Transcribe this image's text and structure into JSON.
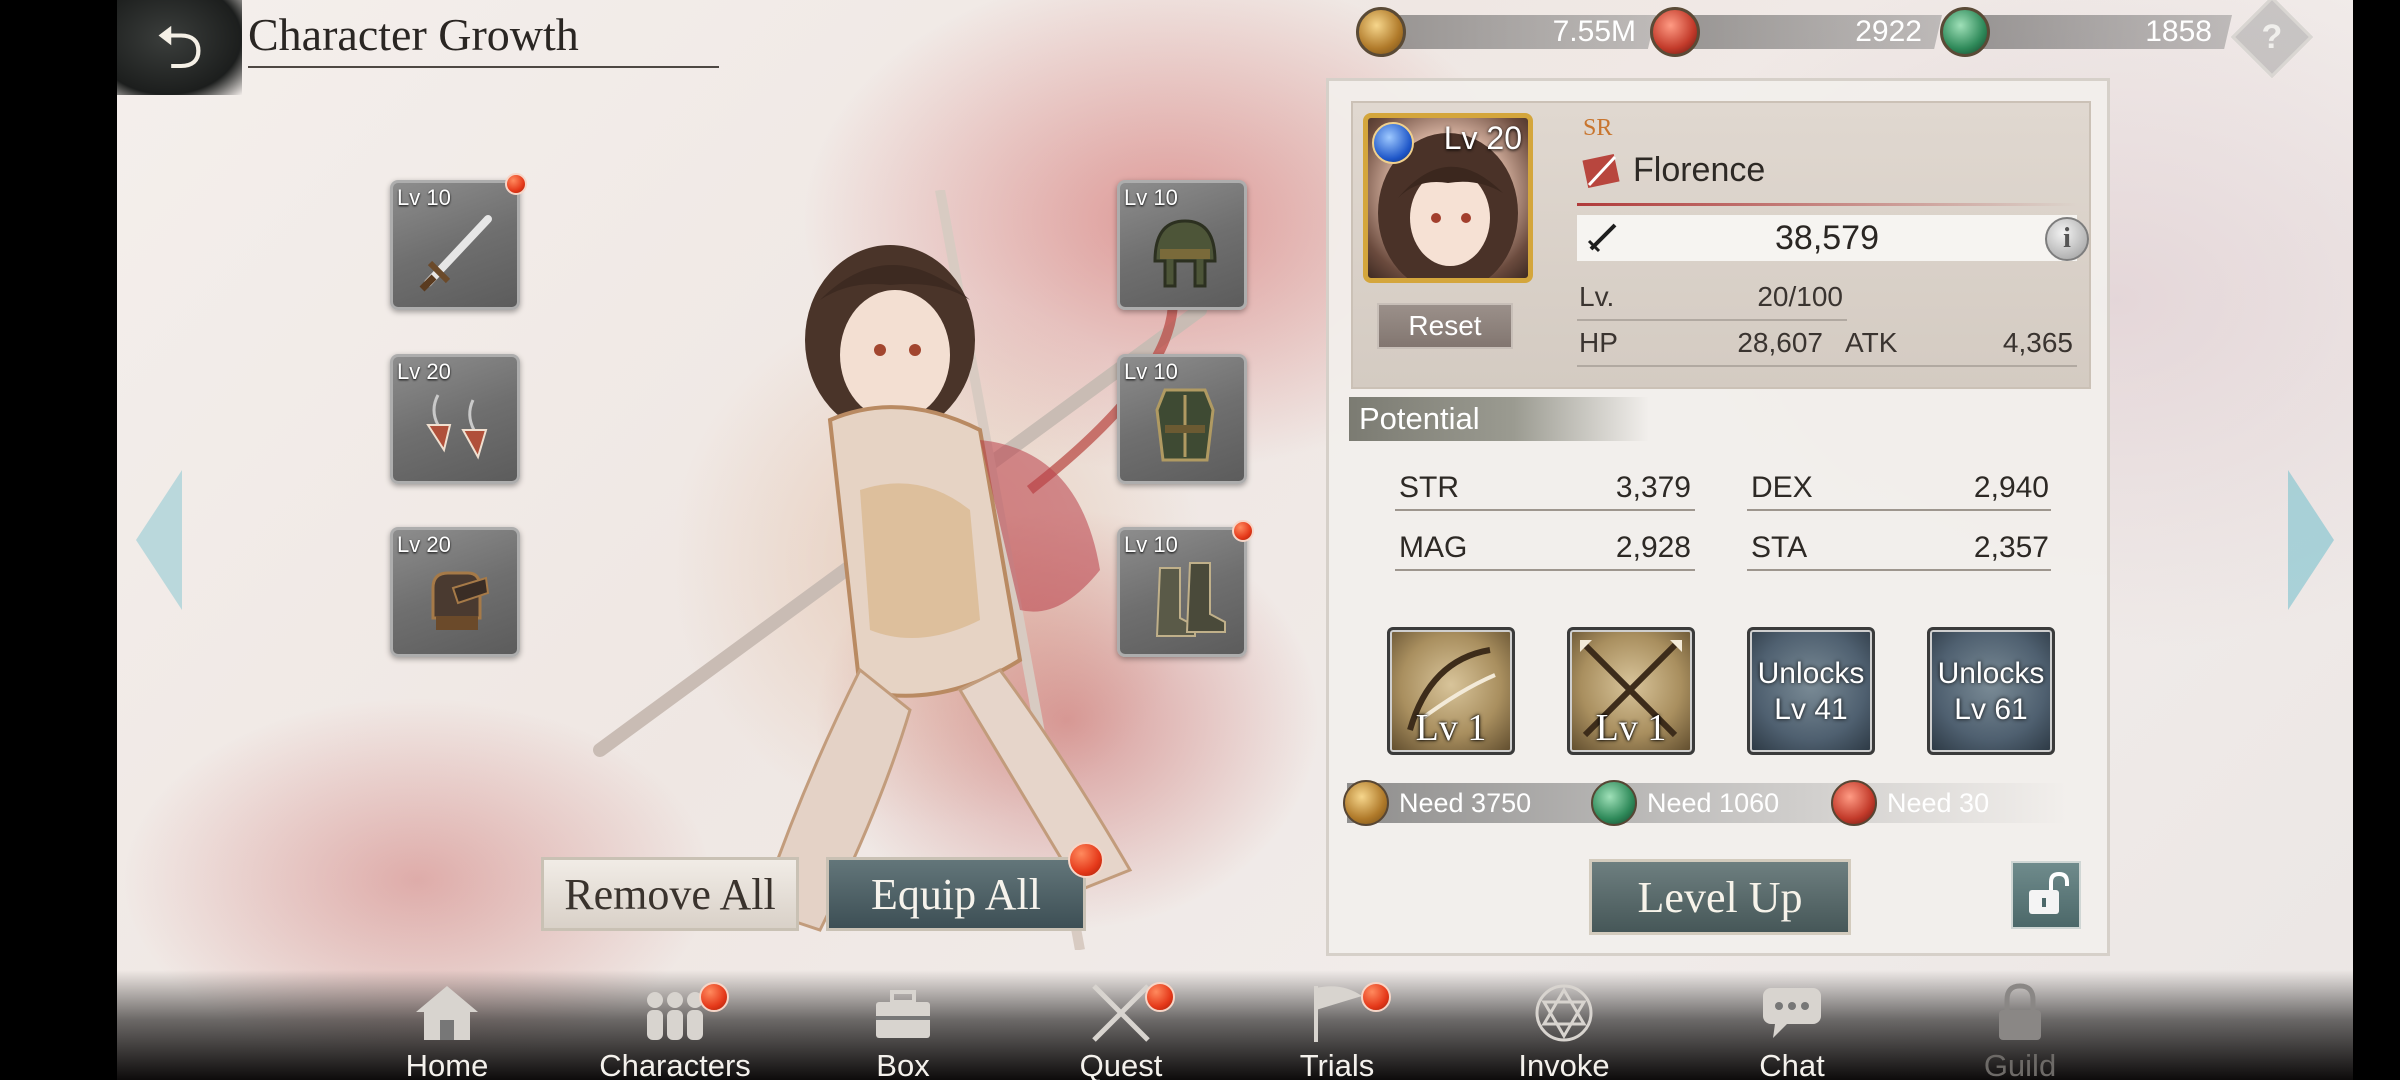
{
  "header": {
    "title": "Character Growth",
    "back_icon": "back-arrow-icon"
  },
  "currencies": [
    {
      "name": "gold",
      "value": "7.55M",
      "color": "#b07a2a"
    },
    {
      "name": "red-gem",
      "value": "2922",
      "color": "#c23a2a"
    },
    {
      "name": "green-gem",
      "value": "1858",
      "color": "#2f8a5a"
    }
  ],
  "help_label": "?",
  "equipment": {
    "left": [
      {
        "slot": "weapon",
        "level": "Lv 10",
        "icon": "sword-icon",
        "alert": true
      },
      {
        "slot": "earrings",
        "level": "Lv 20",
        "icon": "earring-icon",
        "alert": false
      },
      {
        "slot": "gloves",
        "level": "Lv 20",
        "icon": "gauntlet-icon",
        "alert": false
      }
    ],
    "right": [
      {
        "slot": "helmet",
        "level": "Lv 10",
        "icon": "helmet-icon",
        "alert": false
      },
      {
        "slot": "armor",
        "level": "Lv 10",
        "icon": "armor-icon",
        "alert": false
      },
      {
        "slot": "boots",
        "level": "Lv 10",
        "icon": "boots-icon",
        "alert": true
      }
    ]
  },
  "actions": {
    "remove_all": "Remove All",
    "equip_all": "Equip All"
  },
  "character": {
    "level_badge": "Lv 20",
    "rarity": "SR",
    "name": "Florence",
    "power": "38,579",
    "info_label": "i",
    "reset_label": "Reset",
    "lv_label": "Lv.",
    "lv_value": "20/100",
    "hp_label": "HP",
    "hp_value": "28,607",
    "atk_label": "ATK",
    "atk_value": "4,365"
  },
  "potential": {
    "tab_label": "Potential",
    "stats": [
      {
        "label": "STR",
        "value": "3,379"
      },
      {
        "label": "DEX",
        "value": "2,940"
      },
      {
        "label": "MAG",
        "value": "2,928"
      },
      {
        "label": "STA",
        "value": "2,357"
      }
    ],
    "skills": [
      {
        "label": "Lv 1",
        "locked": false
      },
      {
        "label": "Lv 1",
        "locked": false
      },
      {
        "label_line1": "Unlocks",
        "label_line2": "Lv 41",
        "locked": true
      },
      {
        "label_line1": "Unlocks",
        "label_line2": "Lv 61",
        "locked": true
      }
    ],
    "costs": [
      {
        "currency": "gold",
        "text": "Need 3750"
      },
      {
        "currency": "green-gem",
        "text": "Need 1060"
      },
      {
        "currency": "red-gem",
        "text": "Need 30"
      }
    ],
    "level_up_label": "Level Up"
  },
  "bottom_nav": [
    {
      "label": "Home",
      "icon": "home-icon",
      "badge": false,
      "disabled": false
    },
    {
      "label": "Characters",
      "icon": "characters-icon",
      "badge": true,
      "disabled": false
    },
    {
      "label": "Box",
      "icon": "box-icon",
      "badge": false,
      "disabled": false
    },
    {
      "label": "Quest",
      "icon": "crossed-swords-icon",
      "badge": true,
      "disabled": false
    },
    {
      "label": "Trials",
      "icon": "flag-icon",
      "badge": true,
      "disabled": false
    },
    {
      "label": "Invoke",
      "icon": "hexagram-icon",
      "badge": false,
      "disabled": false
    },
    {
      "label": "Chat",
      "icon": "chat-icon",
      "badge": false,
      "disabled": false
    },
    {
      "label": "Guild",
      "icon": "lock-icon",
      "badge": false,
      "disabled": true
    }
  ]
}
